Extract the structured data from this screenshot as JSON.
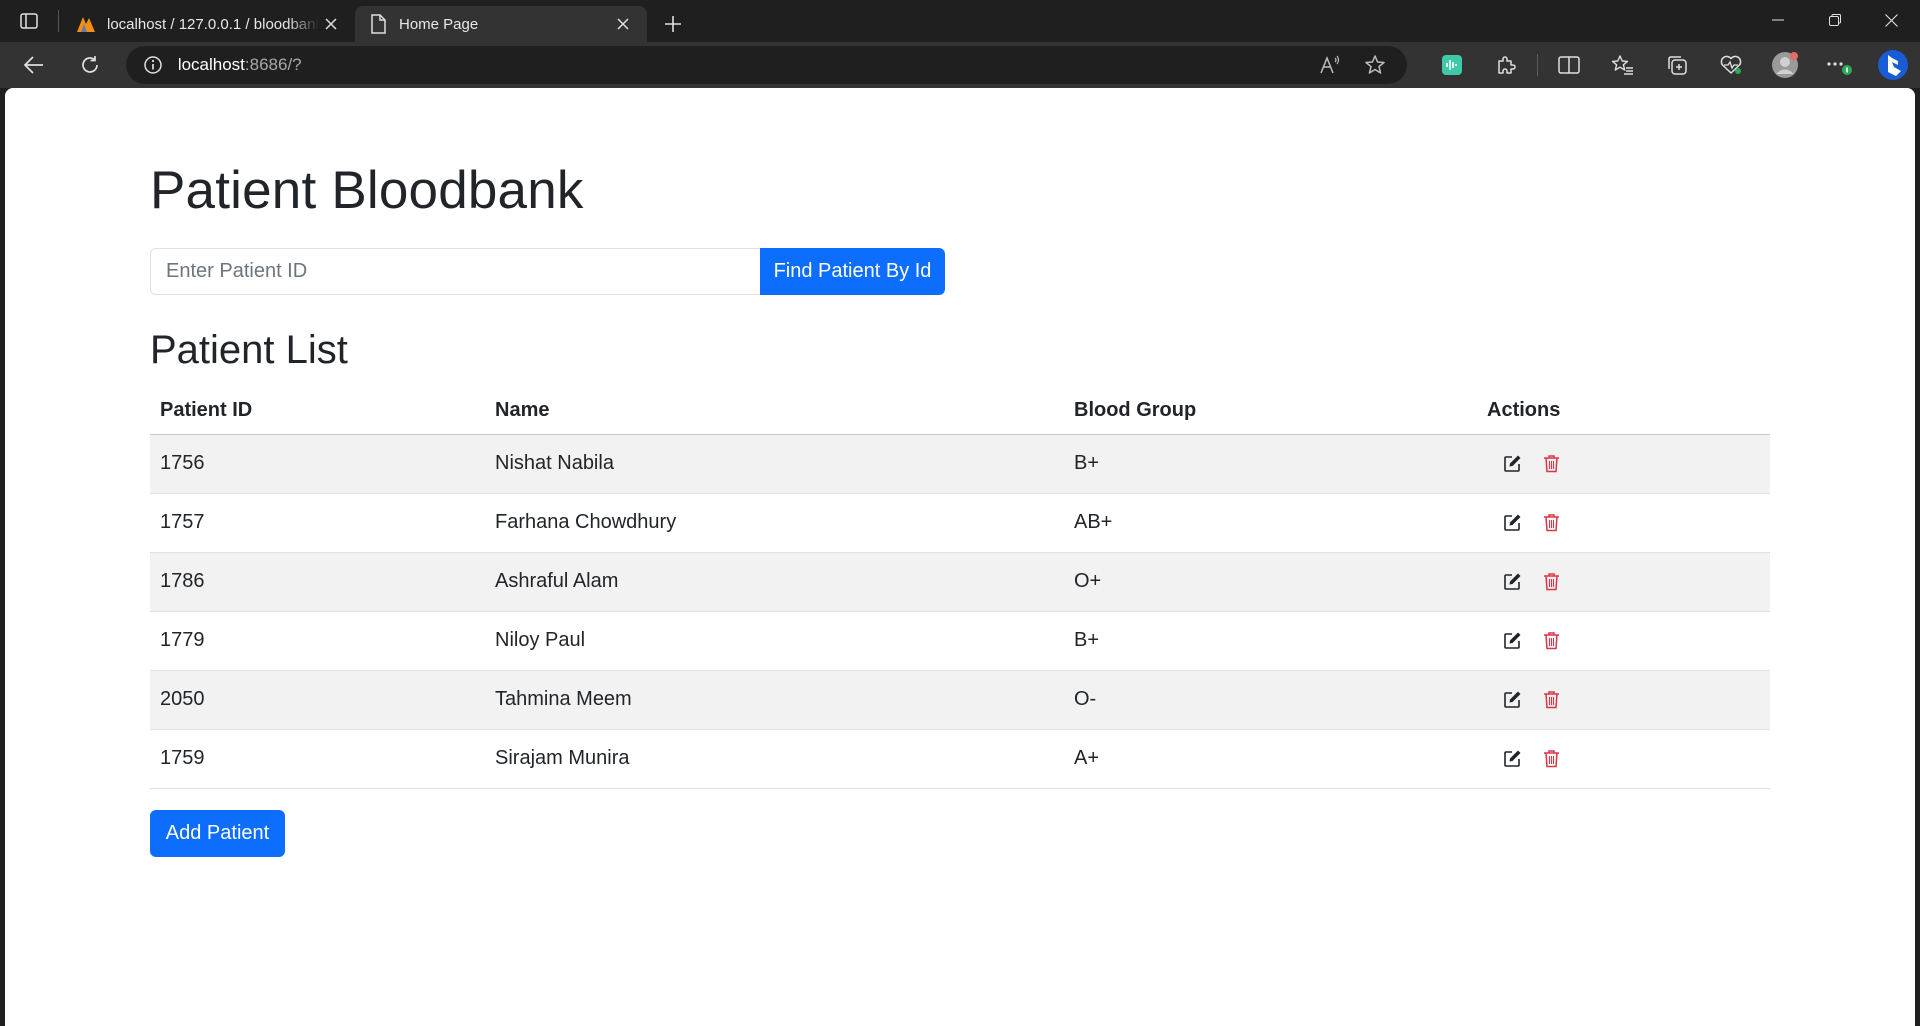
{
  "browser": {
    "tabs": [
      {
        "title": "localhost / 127.0.0.1 / bloodbank",
        "active": false
      },
      {
        "title": "Home Page",
        "active": true
      }
    ],
    "address": {
      "host": "localhost",
      "rest": ":8686/?"
    }
  },
  "page": {
    "title": "Patient Bloodbank",
    "search": {
      "placeholder": "Enter Patient ID",
      "button_label": "Find Patient By Id"
    },
    "list_title": "Patient List",
    "table": {
      "headers": {
        "id": "Patient ID",
        "name": "Name",
        "blood": "Blood Group",
        "actions": "Actions"
      },
      "rows": [
        {
          "id": "1756",
          "name": "Nishat Nabila",
          "blood": "B+"
        },
        {
          "id": "1757",
          "name": "Farhana Chowdhury",
          "blood": "AB+"
        },
        {
          "id": "1786",
          "name": "Ashraful Alam",
          "blood": "O+"
        },
        {
          "id": "1779",
          "name": "Niloy Paul",
          "blood": "B+"
        },
        {
          "id": "2050",
          "name": "Tahmina Meem",
          "blood": "O-"
        },
        {
          "id": "1759",
          "name": "Sirajam Munira",
          "blood": "A+"
        }
      ]
    },
    "add_button_label": "Add Patient"
  },
  "colors": {
    "primary": "#0d6efd",
    "danger": "#dc3545",
    "text": "#212529"
  }
}
